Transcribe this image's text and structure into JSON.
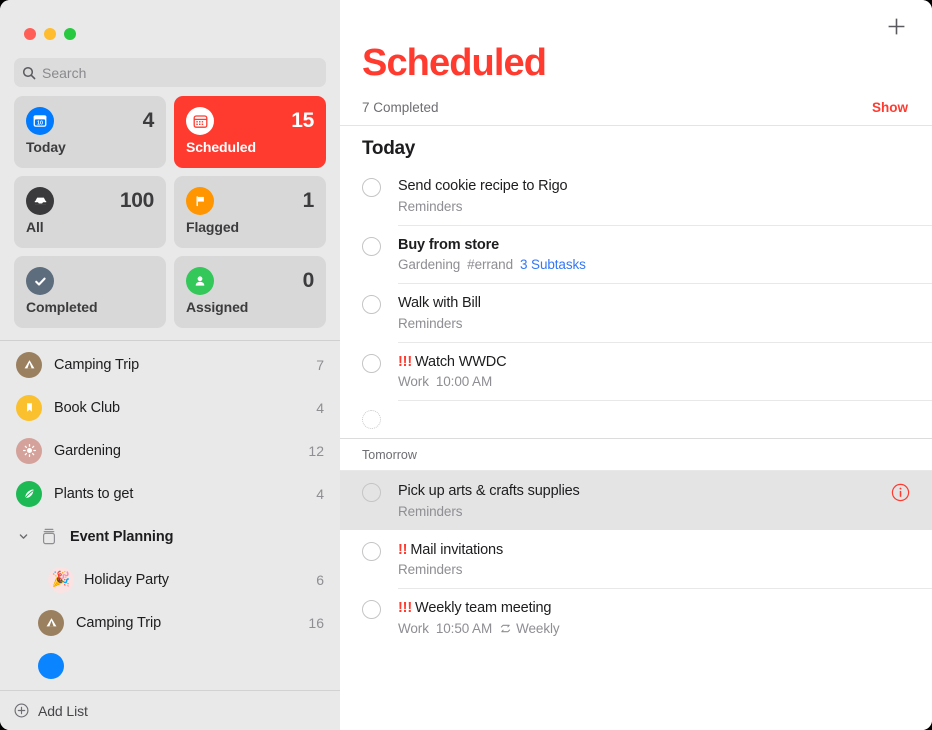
{
  "window": {
    "traffic_lights": [
      "close",
      "minimize",
      "zoom"
    ]
  },
  "sidebar": {
    "search": {
      "placeholder": "Search",
      "value": "",
      "icon": "search-icon"
    },
    "smart_lists": [
      {
        "id": "today",
        "label": "Today",
        "count": "4",
        "icon": "calendar-day-icon",
        "icon_bg": "#007aff",
        "selected": false
      },
      {
        "id": "scheduled",
        "label": "Scheduled",
        "count": "15",
        "icon": "calendar-icon",
        "icon_bg": "#ffffff",
        "selected": true
      },
      {
        "id": "all",
        "label": "All",
        "count": "100",
        "icon": "inbox-tray-icon",
        "icon_bg": "#3a3a3c",
        "selected": false
      },
      {
        "id": "flagged",
        "label": "Flagged",
        "count": "1",
        "icon": "flag-icon",
        "icon_bg": "#ff9500",
        "selected": false
      },
      {
        "id": "completed",
        "label": "Completed",
        "count": "",
        "icon": "checkmark-icon",
        "icon_bg": "#5d6d7e",
        "selected": false
      },
      {
        "id": "assigned",
        "label": "Assigned",
        "count": "0",
        "icon": "person-icon",
        "icon_bg": "#34c759",
        "selected": false
      }
    ],
    "lists": [
      {
        "name": "Camping Trip",
        "count": "7",
        "icon": "tent-icon",
        "icon_bg": "#9b8060"
      },
      {
        "name": "Book Club",
        "count": "4",
        "icon": "bookmark-icon",
        "icon_bg": "#fbc02d"
      },
      {
        "name": "Gardening",
        "count": "12",
        "icon": "sun-icon",
        "icon_bg": "#d4a29a"
      },
      {
        "name": "Plants to get",
        "count": "4",
        "icon": "leaf-icon",
        "icon_bg": "#1db954"
      }
    ],
    "group": {
      "name": "Event Planning",
      "icon": "folder-group-icon",
      "expanded": true,
      "disclosure_icon": "chevron-down-icon",
      "children": [
        {
          "name": "Holiday Party",
          "count": "6",
          "icon": "party-popper-emoji",
          "emoji": "🎉",
          "icon_bg": "#fbe3e3"
        },
        {
          "name": "Camping Trip",
          "count": "16",
          "icon": "tent-icon",
          "icon_bg": "#9b8060"
        }
      ]
    },
    "partial_list": {
      "icon": "blue-circle-icon",
      "icon_bg": "#0a84ff"
    },
    "add_list": {
      "label": "Add List",
      "icon": "plus-circle-icon"
    }
  },
  "main": {
    "add_reminder_button": {
      "icon": "plus-icon"
    },
    "title": "Scheduled",
    "title_color": "#ff3b30",
    "completed_summary": "7 Completed",
    "show_link": "Show",
    "sections": [
      {
        "heading": "Today",
        "heading_style": "large",
        "tasks": [
          {
            "title": "Send cookie recipe to Rigo",
            "bold": false,
            "priority": "",
            "meta": [
              {
                "text": "Reminders",
                "style": "plain"
              }
            ],
            "selected": false,
            "info_icon": false,
            "checkbox": "empty"
          },
          {
            "title": "Buy from store",
            "bold": true,
            "priority": "",
            "meta": [
              {
                "text": "Gardening",
                "style": "plain"
              },
              {
                "text": "#errand",
                "style": "plain"
              },
              {
                "text": "3 Subtasks",
                "style": "link"
              }
            ],
            "selected": false,
            "info_icon": false,
            "checkbox": "empty"
          },
          {
            "title": "Walk with Bill",
            "bold": false,
            "priority": "",
            "meta": [
              {
                "text": "Reminders",
                "style": "plain"
              }
            ],
            "selected": false,
            "info_icon": false,
            "checkbox": "empty"
          },
          {
            "title": "Watch WWDC",
            "bold": false,
            "priority": "!!!",
            "meta": [
              {
                "text": "Work",
                "style": "plain"
              },
              {
                "text": "10:00 AM",
                "style": "plain"
              }
            ],
            "selected": false,
            "info_icon": false,
            "checkbox": "empty"
          },
          {
            "title": "",
            "bold": false,
            "priority": "",
            "meta": [],
            "selected": false,
            "info_icon": false,
            "checkbox": "dotted"
          }
        ]
      },
      {
        "heading": "Tomorrow",
        "heading_style": "small",
        "tasks": [
          {
            "title": "Pick up arts & crafts supplies",
            "bold": false,
            "priority": "",
            "meta": [
              {
                "text": "Reminders",
                "style": "plain"
              }
            ],
            "selected": true,
            "info_icon": true,
            "checkbox": "empty"
          },
          {
            "title": "Mail invitations",
            "bold": false,
            "priority": "!!",
            "meta": [
              {
                "text": "Reminders",
                "style": "plain"
              }
            ],
            "selected": false,
            "info_icon": false,
            "checkbox": "empty"
          },
          {
            "title": "Weekly team meeting",
            "bold": false,
            "priority": "!!!",
            "meta": [
              {
                "text": "Work",
                "style": "plain"
              },
              {
                "text": "10:50 AM",
                "style": "plain"
              },
              {
                "text": "Weekly",
                "style": "repeat",
                "icon": "repeat-icon"
              }
            ],
            "selected": false,
            "info_icon": false,
            "checkbox": "empty"
          }
        ]
      }
    ]
  }
}
